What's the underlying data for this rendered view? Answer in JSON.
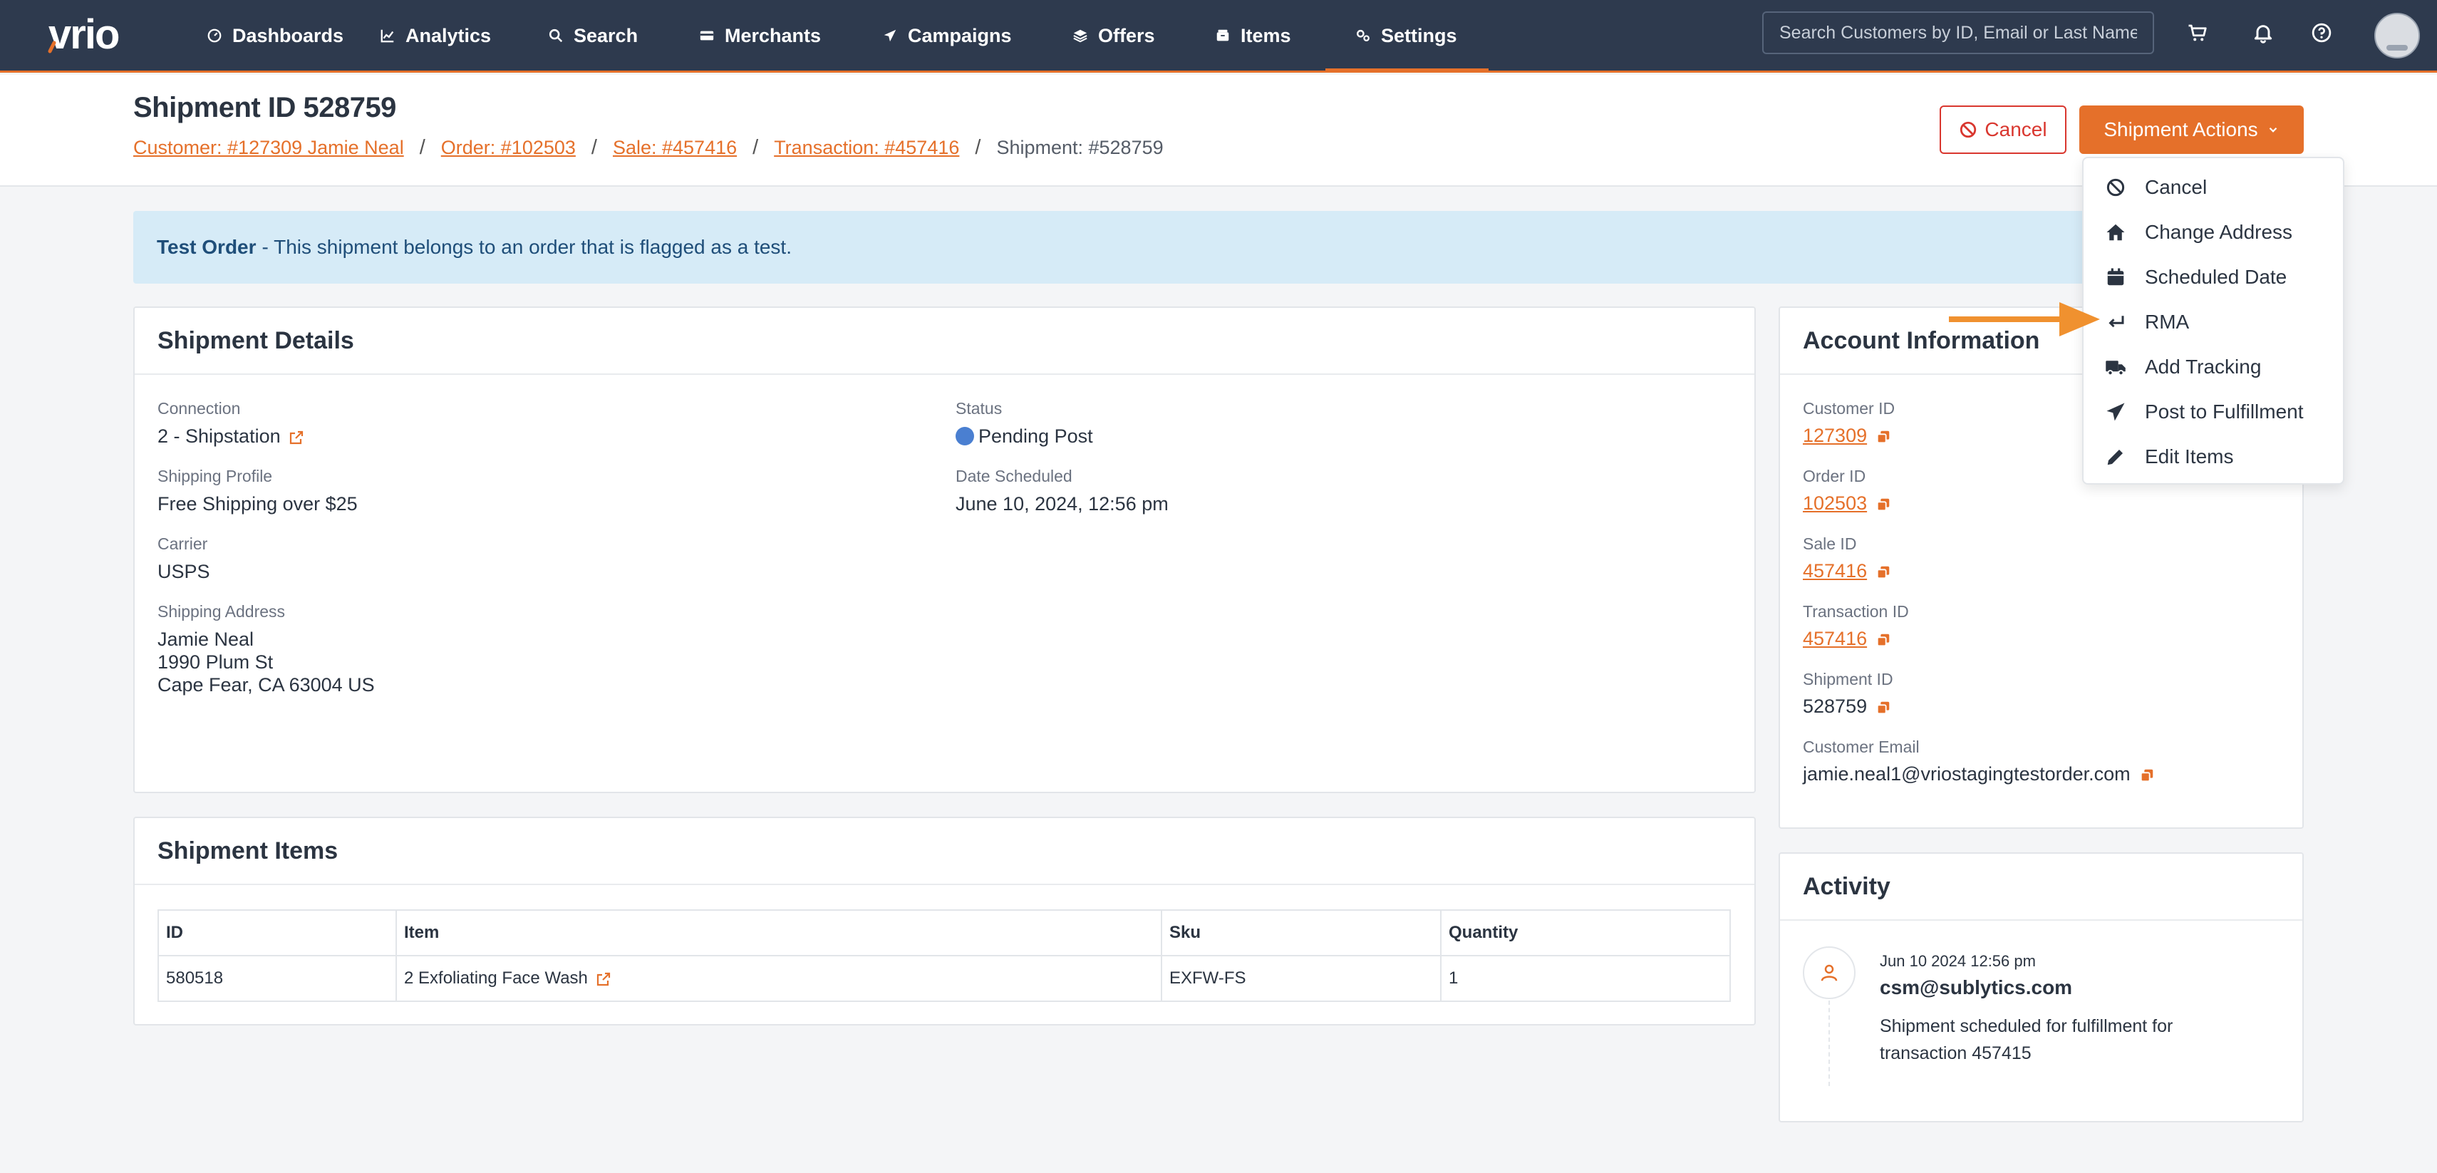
{
  "nav": {
    "logo_text": "vrio",
    "items": [
      {
        "label": "Dashboards",
        "icon": "gauge-icon"
      },
      {
        "label": "Analytics",
        "icon": "line-chart-icon"
      },
      {
        "label": "Search",
        "icon": "search-icon"
      },
      {
        "label": "Merchants",
        "icon": "credit-card-icon"
      },
      {
        "label": "Campaigns",
        "icon": "paper-plane-icon"
      },
      {
        "label": "Offers",
        "icon": "layers-icon"
      },
      {
        "label": "Items",
        "icon": "box-icon"
      },
      {
        "label": "Settings",
        "icon": "gears-icon"
      }
    ],
    "active": "Settings",
    "search_placeholder": "Search Customers by ID, Email or Last Name"
  },
  "header": {
    "title": "Shipment ID 528759",
    "breadcrumb": [
      "Customer: #127309 Jamie Neal",
      "Order: #102503",
      "Sale: #457416",
      "Transaction: #457416",
      "Shipment: #528759"
    ],
    "cancel_label": "Cancel",
    "actions_label": "Shipment Actions"
  },
  "alert": {
    "bold": "Test Order",
    "text": "- This shipment belongs to an order that is flagged as a test."
  },
  "shipment_details": {
    "title": "Shipment Details",
    "connection_label": "Connection",
    "connection_value": "2 - Shipstation",
    "profile_label": "Shipping Profile",
    "profile_value": "Free Shipping over $25",
    "carrier_label": "Carrier",
    "carrier_value": "USPS",
    "address_label": "Shipping Address",
    "address_line1": "Jamie Neal",
    "address_line2": "1990 Plum St",
    "address_line3": "Cape Fear, CA 63004 US",
    "status_label": "Status",
    "status_value": "Pending Post",
    "status_color": "#4a7fd1",
    "scheduled_label": "Date Scheduled",
    "scheduled_value": "June 10, 2024, 12:56 pm"
  },
  "shipment_items": {
    "title": "Shipment Items",
    "columns": [
      "ID",
      "Item",
      "Sku",
      "Quantity"
    ],
    "rows": [
      {
        "id": "580518",
        "item": "2 Exfoliating Face Wash",
        "sku": "EXFW-FS",
        "quantity": "1"
      }
    ]
  },
  "account": {
    "title": "Account Information",
    "customer_id_label": "Customer ID",
    "customer_id": "127309",
    "order_id_label": "Order ID",
    "order_id": "102503",
    "sale_id_label": "Sale ID",
    "sale_id": "457416",
    "transaction_id_label": "Transaction ID",
    "transaction_id": "457416",
    "shipment_id_label": "Shipment ID",
    "shipment_id": "528759",
    "email_label": "Customer Email",
    "email": "jamie.neal1@vriostagingtestorder.com"
  },
  "activity": {
    "title": "Activity",
    "timestamp": "Jun 10 2024 12:56 pm",
    "user": "csm@sublytics.com",
    "message_line1": "Shipment scheduled for fulfillment for",
    "message_line2": "transaction 457415"
  },
  "dropdown": {
    "items": [
      {
        "label": "Cancel",
        "icon": "ban-icon"
      },
      {
        "label": "Change Address",
        "icon": "home-icon"
      },
      {
        "label": "Scheduled Date",
        "icon": "calendar-icon"
      },
      {
        "label": "RMA",
        "icon": "return-arrow-icon"
      },
      {
        "label": "Add Tracking",
        "icon": "truck-icon"
      },
      {
        "label": "Post to Fulfillment",
        "icon": "paper-plane-icon"
      },
      {
        "label": "Edit Items",
        "icon": "pencil-icon"
      }
    ]
  },
  "colors": {
    "nav_bg": "#2e3a4e",
    "accent": "#e5702a",
    "danger": "#d9372f",
    "alert_bg": "#d6ebf7",
    "alert_text": "#1f4e79"
  }
}
